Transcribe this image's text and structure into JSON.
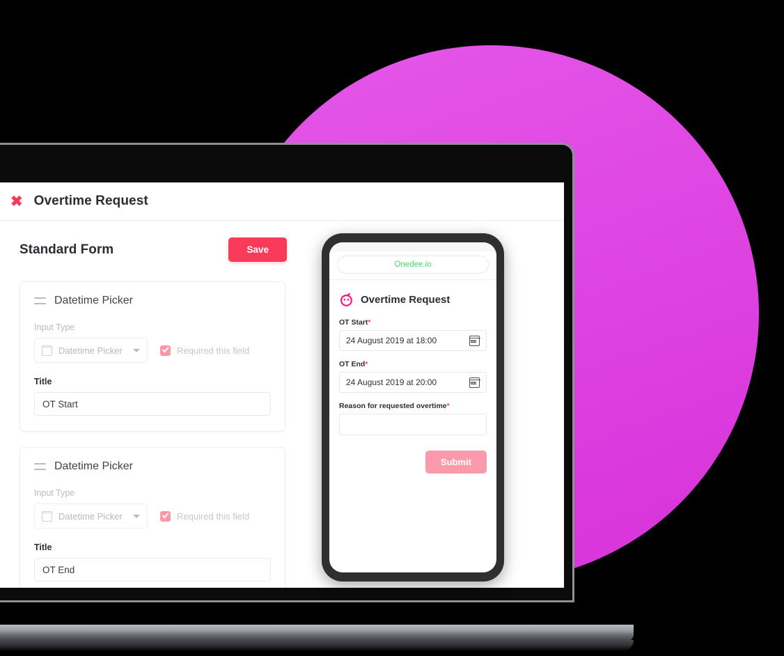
{
  "decor": {
    "circle_color_start": "#e558e9",
    "circle_color_end": "#d731d9"
  },
  "desktop_app": {
    "header": {
      "close_label": "✖",
      "title": "Overtime Request"
    },
    "toolbar": {
      "heading": "Standard Form",
      "save_label": "Save",
      "save_color": "#f93a5a"
    },
    "field_cards": [
      {
        "card_title": "Datetime Picker",
        "input_type_label": "Input Type",
        "input_type_value": "Datetime Picker",
        "required_label": "Required this field",
        "required_checked": true,
        "title_label": "Title",
        "title_value": "OT Start"
      },
      {
        "card_title": "Datetime Picker",
        "input_type_label": "Input Type",
        "input_type_value": "Datetime Picker",
        "required_label": "Required this field",
        "required_checked": true,
        "title_label": "Title",
        "title_value": "OT End"
      }
    ]
  },
  "phone_app": {
    "url_text": "Onedee.io",
    "url_color": "#4ad46a",
    "brand_title": "Overtime Request",
    "fields": [
      {
        "label": "OT Start",
        "required_mark": "*",
        "value": "24 August 2019 at 18:00",
        "icon": "calendar-icon"
      },
      {
        "label": "OT End",
        "required_mark": "*",
        "value": "24 August 2019 at 20:00",
        "icon": "calendar-icon"
      },
      {
        "label": "Reason for requested overtime",
        "required_mark": "*",
        "value": "",
        "icon": ""
      }
    ],
    "submit_label": "Submit",
    "submit_color": "#fb9aaa"
  }
}
